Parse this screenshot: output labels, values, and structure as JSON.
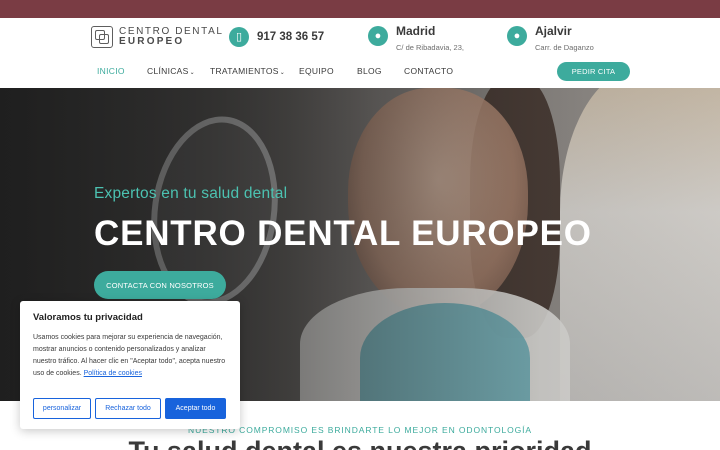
{
  "logo": {
    "line1": "CENTRO DENTAL",
    "line2": "EUROPEO"
  },
  "header": {
    "phone": "917 38 36 57",
    "locations": [
      {
        "city": "Madrid",
        "address": "C/ de Ribadavia, 23,"
      },
      {
        "city": "Ajalvir",
        "address": "Carr. de Daganzo"
      }
    ]
  },
  "nav": {
    "items": [
      {
        "label": "INICIO",
        "dropdown": false,
        "active": true
      },
      {
        "label": "CLÍNICAS",
        "dropdown": true,
        "active": false
      },
      {
        "label": "TRATAMIENTOS",
        "dropdown": true,
        "active": false
      },
      {
        "label": "EQUIPO",
        "dropdown": false,
        "active": false
      },
      {
        "label": "BLOG",
        "dropdown": false,
        "active": false
      },
      {
        "label": "CONTACTO",
        "dropdown": false,
        "active": false
      }
    ],
    "cta": "PEDIR CITA",
    "caret": "⌄"
  },
  "hero": {
    "subtitle": "Expertos en tu salud dental",
    "title": "CENTRO DENTAL EUROPEO",
    "button": "CONTACTA CON NOSOTROS"
  },
  "section": {
    "tagline": "NUESTRO COMPROMISO ES BRINDARTE LO MEJOR EN ODONTOLOGÍA",
    "heading": "Tu salud dental es nuestra prioridad"
  },
  "cookie": {
    "title": "Valoramos tu privacidad",
    "body": "Usamos cookies para mejorar su experiencia de navegación, mostrar anuncios o contenido personalizados y analizar nuestro tráfico. Al hacer clic en \"Aceptar todo\", acepta nuestro uso de cookies.",
    "link": "Política de cookies",
    "buttons": {
      "customize": "personalizar",
      "reject": "Rechazar todo",
      "accept": "Aceptar todo"
    }
  },
  "colors": {
    "accent": "#3dab9d",
    "topbar": "#7a3c44",
    "cookie_blue": "#1863dc"
  },
  "icons": {
    "phone": "mobile-phone-icon",
    "location": "map-pin-icon"
  }
}
